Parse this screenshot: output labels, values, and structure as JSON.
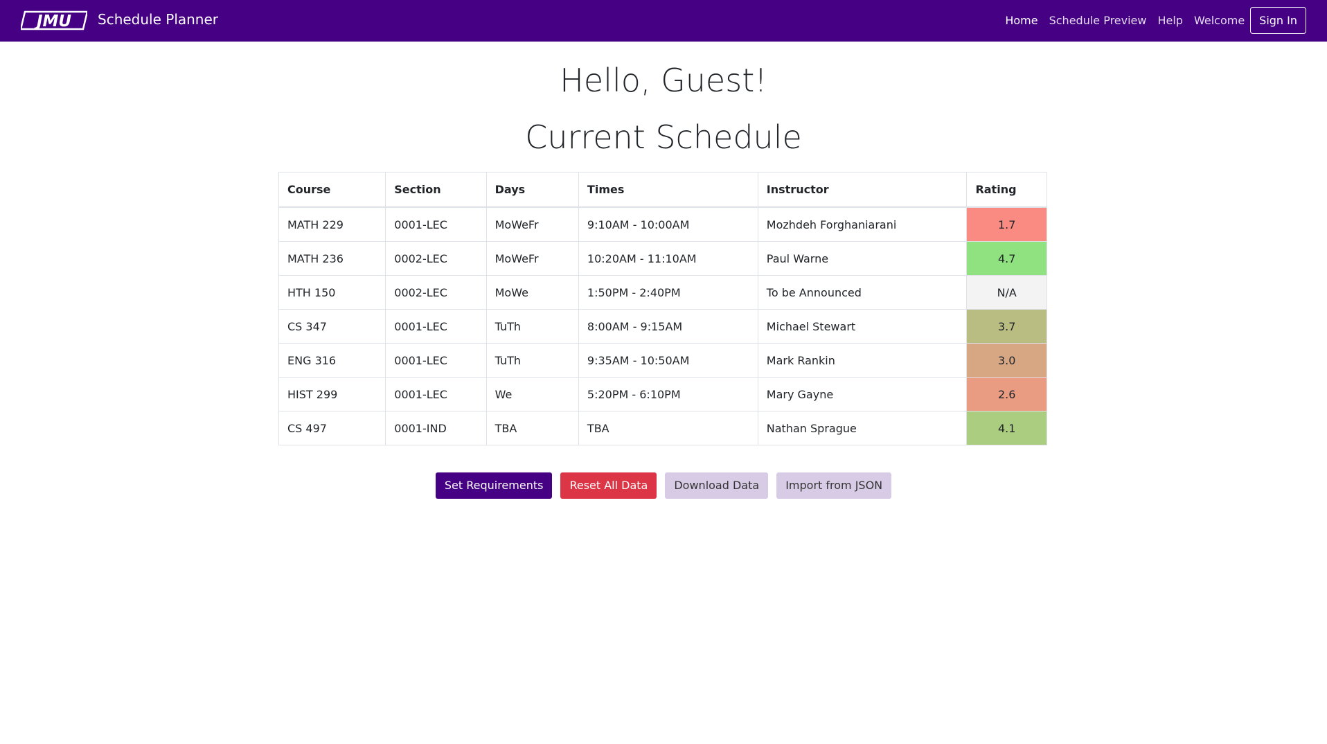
{
  "navbar": {
    "brand_logo_text": "JMU",
    "brand_title": "Schedule Planner",
    "links": [
      {
        "label": "Home",
        "active": true
      },
      {
        "label": "Schedule Preview",
        "active": false
      },
      {
        "label": "Help",
        "active": false
      },
      {
        "label": "Welcome",
        "active": false
      }
    ],
    "signin_label": "Sign In",
    "background_color": "#450084"
  },
  "main": {
    "greeting": "Hello, Guest!",
    "schedule_title": "Current Schedule"
  },
  "table": {
    "headers": [
      "Course",
      "Section",
      "Days",
      "Times",
      "Instructor",
      "Rating"
    ],
    "rows": [
      {
        "course": "MATH 229",
        "section": "0001-LEC",
        "days": "MoWeFr",
        "times": "9:10AM - 10:00AM",
        "instructor": "Mozhdeh Forghaniarani",
        "rating": "1.7",
        "rating_color": "#fa8b82"
      },
      {
        "course": "MATH 236",
        "section": "0002-LEC",
        "days": "MoWeFr",
        "times": "10:20AM - 11:10AM",
        "instructor": "Paul Warne",
        "rating": "4.7",
        "rating_color": "#8fe27f"
      },
      {
        "course": "HTH 150",
        "section": "0002-LEC",
        "days": "MoWe",
        "times": "1:50PM - 2:40PM",
        "instructor": "To be Announced",
        "rating": "N/A",
        "rating_color": "#f3f3f3"
      },
      {
        "course": "CS 347",
        "section": "0001-LEC",
        "days": "TuTh",
        "times": "8:00AM - 9:15AM",
        "instructor": "Michael Stewart",
        "rating": "3.7",
        "rating_color": "#b9bd81"
      },
      {
        "course": "ENG 316",
        "section": "0001-LEC",
        "days": "TuTh",
        "times": "9:35AM - 10:50AM",
        "instructor": "Mark Rankin",
        "rating": "3.0",
        "rating_color": "#d7a682"
      },
      {
        "course": "HIST 299",
        "section": "0001-LEC",
        "days": "We",
        "times": "5:20PM - 6:10PM",
        "instructor": "Mary Gayne",
        "rating": "2.6",
        "rating_color": "#e99c82"
      },
      {
        "course": "CS 497",
        "section": "0001-IND",
        "days": "TBA",
        "times": "TBA",
        "instructor": "Nathan Sprague",
        "rating": "4.1",
        "rating_color": "#aacd80"
      }
    ]
  },
  "actions": {
    "set_requirements": "Set Requirements",
    "reset_all": "Reset All Data",
    "download": "Download Data",
    "import_json": "Import from JSON"
  }
}
